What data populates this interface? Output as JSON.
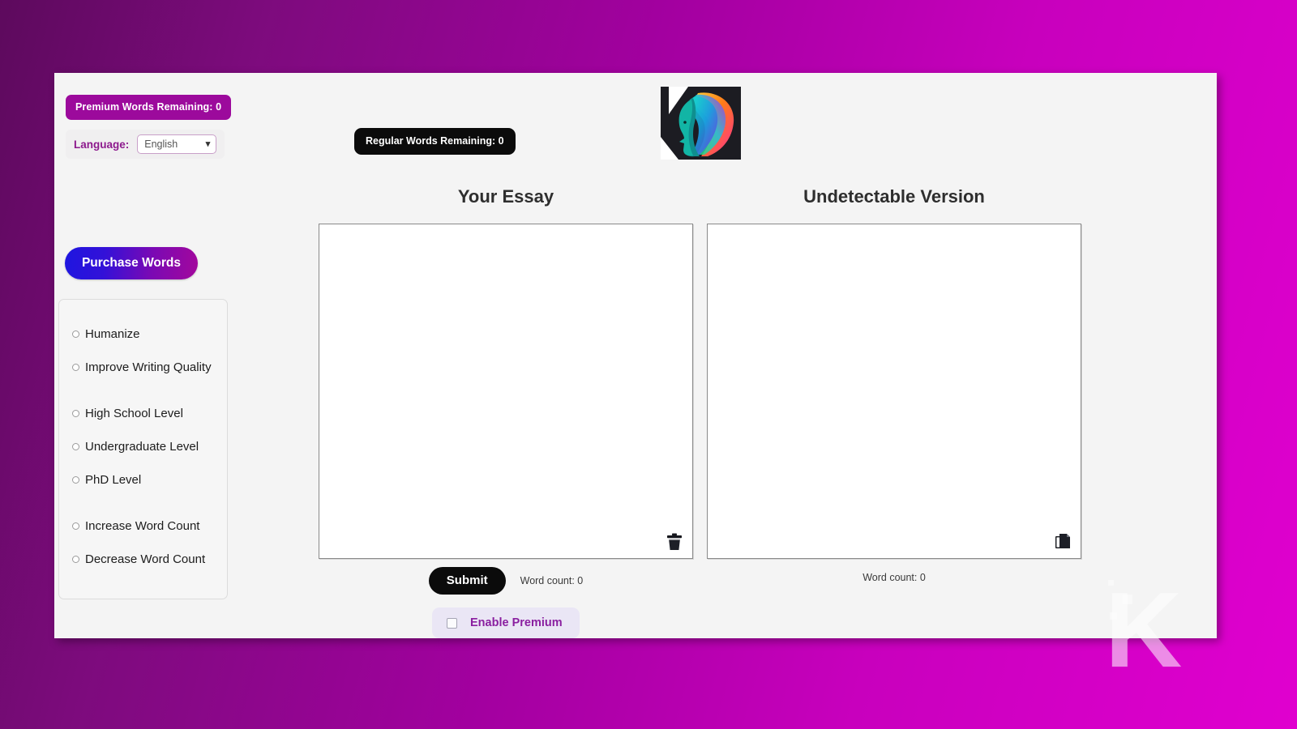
{
  "theme": {
    "background_gradient_from": "#5d0a5d",
    "background_gradient_to": "#e000cf",
    "card_background": "#f4f4f4",
    "premium_badge_color": "#9c0a9c",
    "regular_badge_color": "#0b0b0b",
    "accent_purple": "#8a1fa0",
    "purchase_gradient_from": "#1e16e0",
    "purchase_gradient_to": "#a3089c"
  },
  "sidebar": {
    "premium_badge": "Premium Words Remaining: 0",
    "language_label": "Language:",
    "language_selected": "English",
    "language_options": [
      "English"
    ],
    "purchase_button": "Purchase Words",
    "options": [
      {
        "label": "Humanize",
        "selected": false,
        "gap_before": false
      },
      {
        "label": "Improve Writing Quality",
        "selected": false,
        "gap_before": false
      },
      {
        "label": "High School Level",
        "selected": false,
        "gap_before": true
      },
      {
        "label": "Undergraduate Level",
        "selected": false,
        "gap_before": false
      },
      {
        "label": "PhD Level",
        "selected": false,
        "gap_before": false
      },
      {
        "label": "Increase Word Count",
        "selected": false,
        "gap_before": true
      },
      {
        "label": "Decrease Word Count",
        "selected": false,
        "gap_before": false
      }
    ]
  },
  "header": {
    "regular_badge": "Regular Words Remaining: 0",
    "logo_icon": "colorful-face-profile-logo"
  },
  "main": {
    "left_pane": {
      "title": "Your Essay",
      "textarea_value": "",
      "textarea_placeholder": "",
      "action_icon": "trash-icon",
      "word_count": "Word count: 0"
    },
    "right_pane": {
      "title": "Undetectable Version",
      "textarea_value": "",
      "textarea_placeholder": "",
      "action_icon": "copy-icon",
      "word_count": "Word count: 0"
    },
    "submit_button": "Submit",
    "premium_toggle_label": "Enable Premium",
    "premium_toggle_checked": false
  },
  "watermark": {
    "letter": "K"
  }
}
